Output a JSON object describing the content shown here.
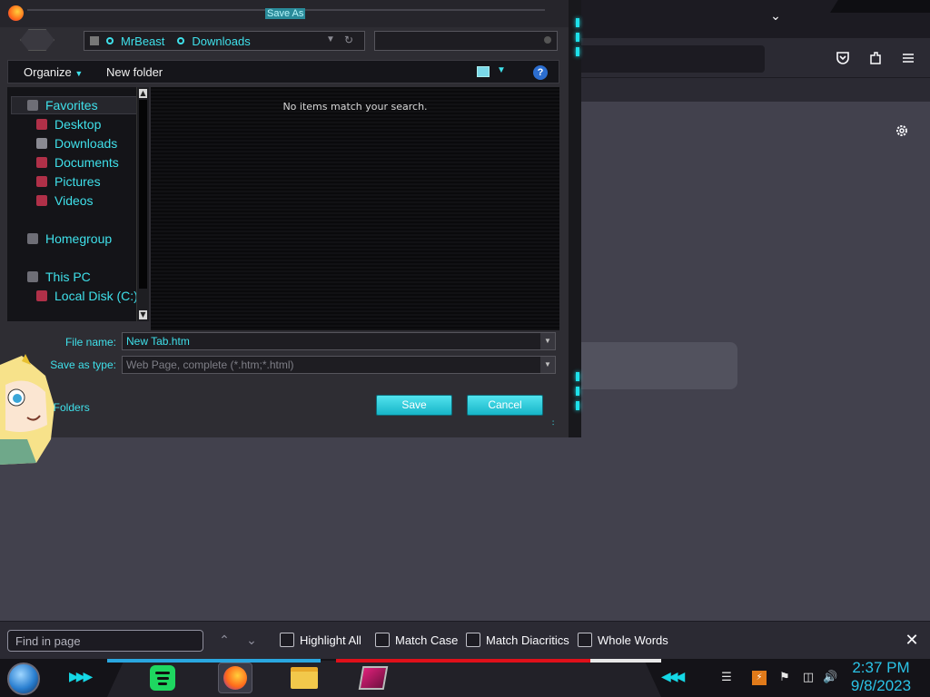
{
  "dialog": {
    "title": "Save As",
    "breadcrumb": [
      "MrBeast",
      "Downloads"
    ],
    "toolbar": {
      "organize": "Organize",
      "new_folder": "New folder"
    },
    "nav": {
      "favorites": "Favorites",
      "items": [
        "Desktop",
        "Downloads",
        "Documents",
        "Pictures",
        "Videos"
      ],
      "homegroup": "Homegroup",
      "this_pc": "This PC",
      "local_disk": "Local Disk (C:)"
    },
    "empty_message": "No items match your search.",
    "file_name_label": "File name:",
    "file_name_value": "New Tab.htm",
    "save_type_label": "Save as type:",
    "save_type_value": "Web Page, complete (*.htm;*.html)",
    "hide_folders": "de Folders",
    "save_button": "Save",
    "cancel_button": "Cancel"
  },
  "findbar": {
    "placeholder": "Find in page",
    "highlight_all": "Highlight All",
    "match_case": "Match Case",
    "match_diacritics": "Match Diacritics",
    "whole_words": "Whole Words"
  },
  "taskbar": {
    "time": "2:37 PM",
    "date": "9/8/2023"
  },
  "colors": {
    "accent": "#3fe0ea",
    "button": "#17b5c8"
  }
}
